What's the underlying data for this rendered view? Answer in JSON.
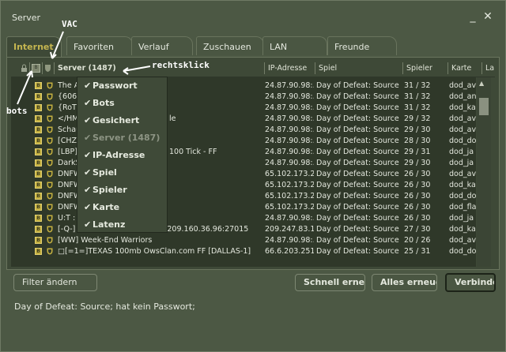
{
  "window": {
    "title": "Server",
    "minimize_icon": "minimize-icon",
    "close_icon": "close-icon",
    "minimize_label": "_",
    "close_label": "✕"
  },
  "tabs": [
    {
      "label": "Internet",
      "active": true
    },
    {
      "label": "Favoriten"
    },
    {
      "label": "Verlauf"
    },
    {
      "label": "Zuschauen"
    },
    {
      "label": "LAN"
    },
    {
      "label": "Freunde"
    }
  ],
  "columns": {
    "icons": {
      "lock": "lock-icon",
      "bots": "bots-icon",
      "vac": "shield-icon",
      "bots_label": "B"
    },
    "server": "Server (1487)",
    "ip": "IP-Adresse",
    "game": "Spiel",
    "players": "Spieler",
    "map": "Karte",
    "latency": "La"
  },
  "rows": [
    {
      "name": "The A",
      "ip": "24.87.90.98:...",
      "game": "Day of Defeat: Source",
      "players": "31 / 32",
      "map": "dod_av"
    },
    {
      "name": "{606",
      "ip": "24.87.90.98:...",
      "game": "Day of Defeat: Source",
      "players": "31 / 32",
      "map": "dod_an"
    },
    {
      "name": "{RoT}",
      "ip": "24.87.90.98:...",
      "game": "Day of Defeat: Source",
      "players": "31 / 32",
      "map": "dod_ka"
    },
    {
      "name": "</HM",
      "ip": "24.87.90.98:...",
      "game": "Day of Defeat: Source",
      "players": "29 / 32",
      "map": "dod_av",
      "tail": "le"
    },
    {
      "name": "Schau",
      "ip": "24.87.90.98:...",
      "game": "Day of Defeat: Source",
      "players": "29 / 30",
      "map": "dod_av"
    },
    {
      "name": "[CHZ]",
      "ip": "24.87.90.98:...",
      "game": "Day of Defeat: Source",
      "players": "28 / 30",
      "map": "dod_do"
    },
    {
      "name": "[LBP]",
      "ip": "24.87.90.98:...",
      "game": "Day of Defeat: Source",
      "players": "29 / 31",
      "map": "dod_ja",
      "tail": "100 Tick - FF"
    },
    {
      "name": "DarkS",
      "ip": "24.87.90.98:...",
      "game": "Day of Defeat: Source",
      "players": "29 / 30",
      "map": "dod_ja"
    },
    {
      "name": "DNFW",
      "ip": "65.102.173.2...",
      "game": "Day of Defeat: Source",
      "players": "26 / 30",
      "map": "dod_av"
    },
    {
      "name": "DNFW",
      "ip": "65.102.173.2...",
      "game": "Day of Defeat: Source",
      "players": "26 / 30",
      "map": "dod_ka"
    },
    {
      "name": "DNFW",
      "ip": "65.102.173.2...",
      "game": "Day of Defeat: Source",
      "players": "26 / 30",
      "map": "dod_do"
    },
    {
      "name": "DNFW",
      "ip": "65.102.173.2...",
      "game": "Day of Defeat: Source",
      "players": "26 / 30",
      "map": "dod_fla"
    },
    {
      "name": "U:T :",
      "ip": "24.87.90.98:...",
      "game": "Day of Defeat: Source",
      "players": "26 / 30",
      "map": "dod_ja"
    },
    {
      "name": "[-Q-] DoD Server - NEW IP IS 209.160.36.96:27015",
      "ip": "209.247.83.1...",
      "game": "Day of Defeat: Source",
      "players": "27 / 30",
      "map": "dod_ka"
    },
    {
      "name": "[WW] Week-End Warriors",
      "ip": "24.87.90.98:...",
      "game": "Day of Defeat: Source",
      "players": "20 / 26",
      "map": "dod_av"
    },
    {
      "name": "□[=1=]TEXAS 100mb OwsClan.com FF [DALLAS-1]",
      "ip": "66.6.203.251...",
      "game": "Day of Defeat: Source",
      "players": "25 / 31",
      "map": "dod_do"
    }
  ],
  "context_menu": [
    {
      "label": "Passwort",
      "checked": true
    },
    {
      "label": "Bots",
      "checked": true
    },
    {
      "label": "Gesichert",
      "checked": true
    },
    {
      "label": "Server (1487)",
      "checked": true,
      "disabled": true
    },
    {
      "label": "IP-Adresse",
      "checked": true
    },
    {
      "label": "Spiel",
      "checked": true
    },
    {
      "label": "Spieler",
      "checked": true
    },
    {
      "label": "Karte",
      "checked": true
    },
    {
      "label": "Latenz",
      "checked": true
    }
  ],
  "check_glyph": "✔",
  "buttons": {
    "filter": "Filter ändern",
    "quick_refresh": "Schnell erneuern",
    "refresh_all": "Alles erneuern",
    "connect": "Verbinden"
  },
  "status": "Day of Defeat: Source; hat kein Passwort;",
  "annotations": {
    "vac": "VAC",
    "right_click": "rechtsklick",
    "bots": "bots"
  },
  "colors": {
    "background": "#4c5844",
    "list": "#2f3829",
    "active_tab": "#c4b550",
    "badge": "#c4b040"
  }
}
